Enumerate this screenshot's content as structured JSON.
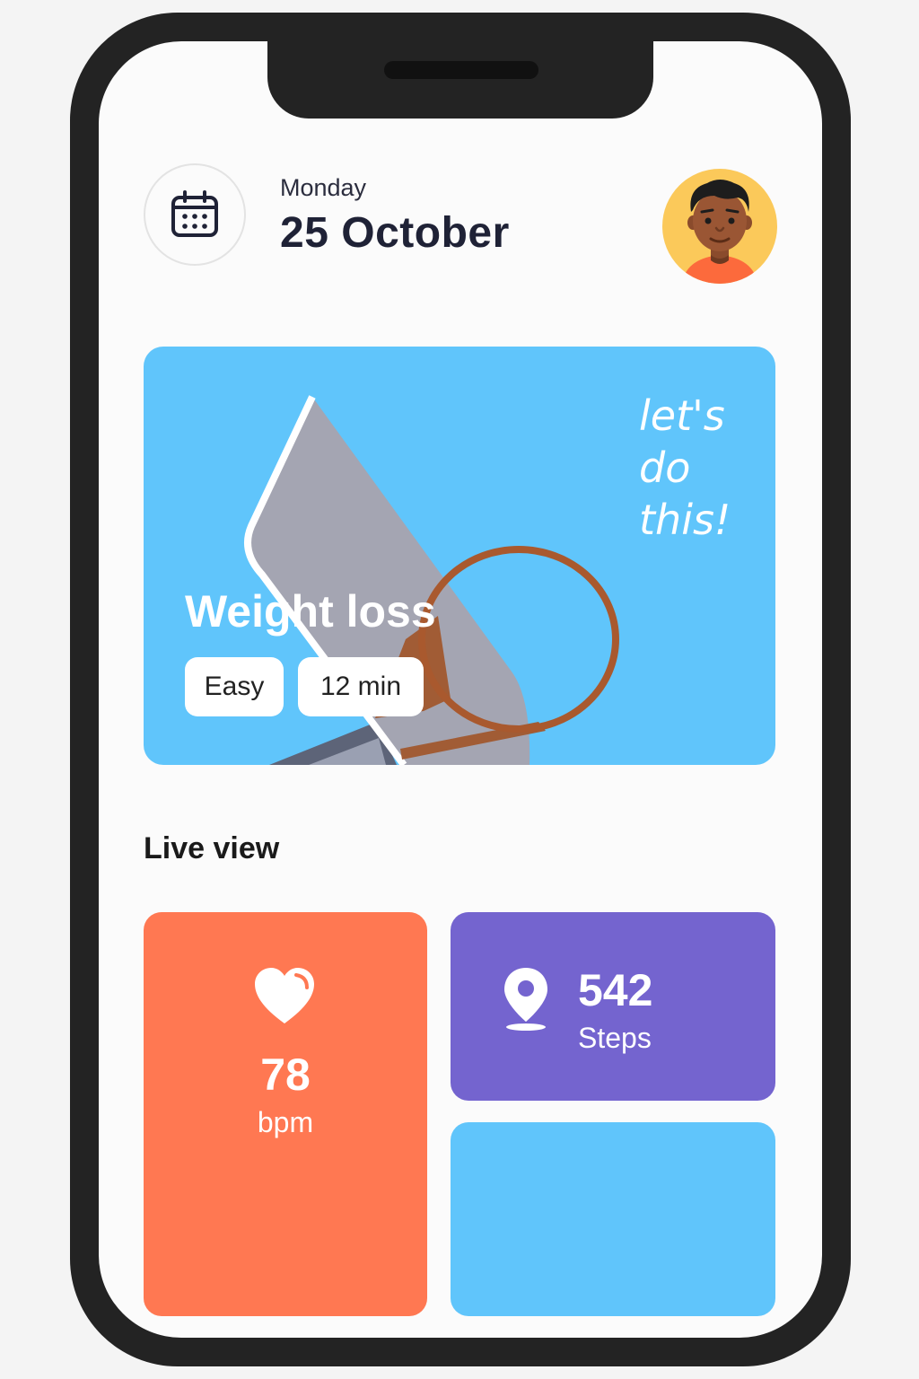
{
  "header": {
    "day": "Monday",
    "date": "25 October",
    "calendar_icon": "calendar-icon",
    "avatar_icon": "user-avatar"
  },
  "workout": {
    "title": "Weight loss",
    "difficulty": "Easy",
    "duration": "12 min",
    "slogan": [
      "let's",
      "do",
      "this!"
    ],
    "background_color": "#60c5fb"
  },
  "live_view": {
    "title": "Live view",
    "heart_rate": {
      "value": "78",
      "unit": "bpm",
      "icon": "heart-icon",
      "color": "#ff7852"
    },
    "steps": {
      "value": "542",
      "unit": "Steps",
      "icon": "location-pin-icon",
      "color": "#7464cf"
    },
    "extra_card_color": "#60c5fb"
  }
}
